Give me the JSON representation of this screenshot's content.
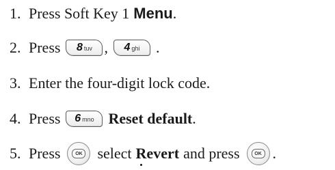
{
  "steps": [
    {
      "number": "1.",
      "prefix": "Press Soft Key 1",
      "emphasis": "Menu",
      "suffix": "."
    },
    {
      "number": "2.",
      "prefix": "Press",
      "keys": [
        {
          "digit": "8",
          "letters": "tuv",
          "icon": "key-8-tuv"
        },
        {
          "digit": "4",
          "letters": "ghi",
          "icon": "key-4-ghi"
        }
      ],
      "separator": ",",
      "suffix": "."
    },
    {
      "number": "3.",
      "text": "Enter the four-digit lock code."
    },
    {
      "number": "4.",
      "prefix": "Press",
      "key": {
        "digit": "6",
        "letters": "mno",
        "icon": "key-6-mno"
      },
      "emphasis": "Reset default",
      "suffix": "."
    },
    {
      "number": "5.",
      "prefix": "Press",
      "ok_key_label": "OK",
      "middle": "select",
      "emphasis": "Revert",
      "and_press": "and press",
      "suffix": "."
    }
  ]
}
